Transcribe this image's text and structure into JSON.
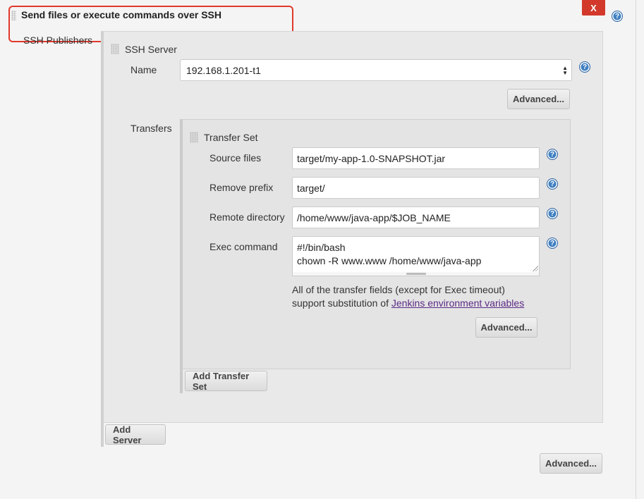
{
  "section": {
    "title": "Send files or execute commands over SSH",
    "close_label": "X",
    "help_label": "?"
  },
  "publishers": {
    "label": "SSH Publishers",
    "server": {
      "title": "SSH Server",
      "name_label": "Name",
      "name_value": "192.168.1.201-t1",
      "advanced_label": "Advanced..."
    },
    "transfers_label": "Transfers",
    "transfer_set": {
      "title": "Transfer Set",
      "fields": {
        "source_files": {
          "label": "Source files",
          "value": "target/my-app-1.0-SNAPSHOT.jar"
        },
        "remove_prefix": {
          "label": "Remove prefix",
          "value": "target/"
        },
        "remote_directory": {
          "label": "Remote directory",
          "value": "/home/www/java-app/$JOB_NAME"
        },
        "exec_command": {
          "label": "Exec command",
          "value": "#!/bin/bash\nchown -R www.www /home/www/java-app"
        }
      },
      "note_line1": "All of the transfer fields (except for Exec timeout)",
      "note_line2_prefix": "support substitution of ",
      "note_link": "Jenkins environment variables",
      "advanced_label": "Advanced..."
    },
    "add_transfer_set_label": "Add Transfer Set",
    "add_server_label": "Add Server"
  },
  "footer": {
    "advanced_label": "Advanced..."
  },
  "colors": {
    "close_button": "#d2392b",
    "highlight_border": "#e0392b",
    "help_icon": "#3e7fc1",
    "link": "#5b2a86"
  }
}
